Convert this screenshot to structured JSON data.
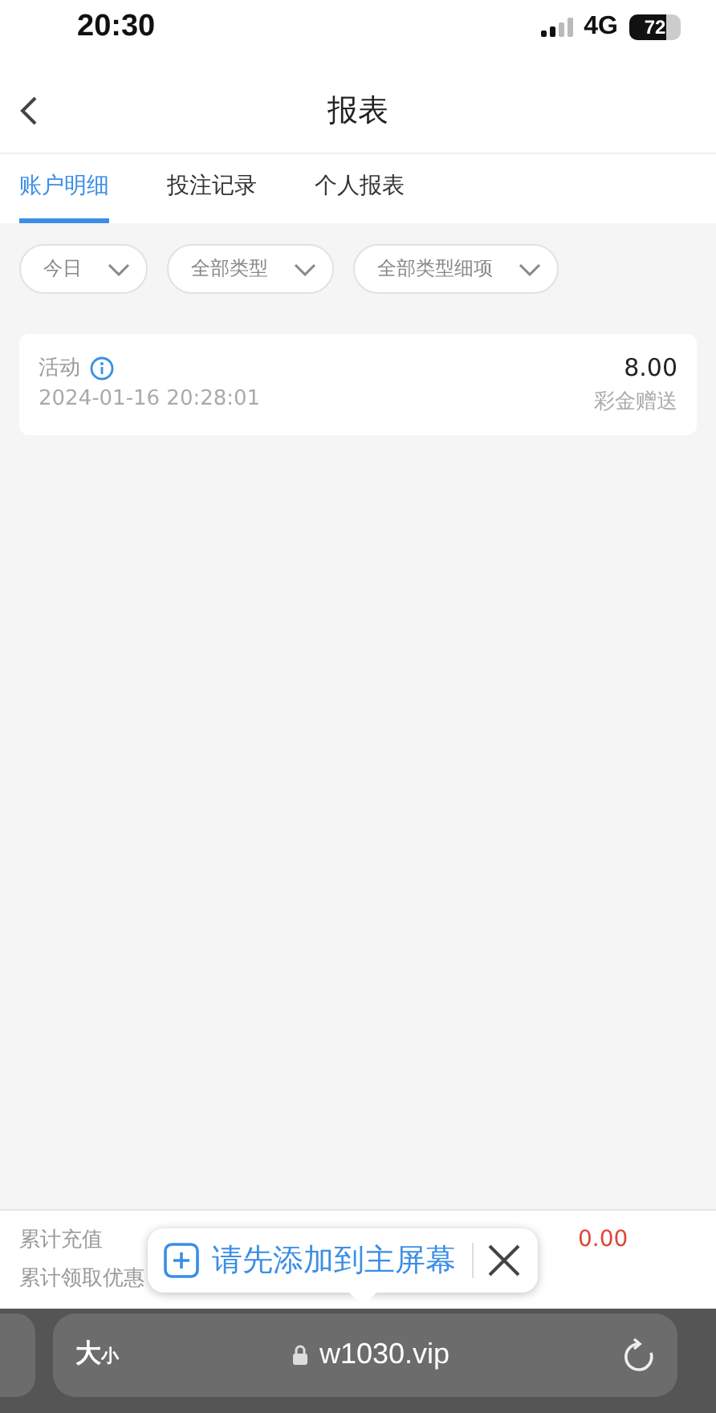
{
  "status_bar": {
    "time": "20:30",
    "network": "4G",
    "battery": "72"
  },
  "header": {
    "title": "报表"
  },
  "tabs": [
    {
      "label": "账户明细",
      "selected": true
    },
    {
      "label": "投注记录",
      "selected": false
    },
    {
      "label": "个人报表",
      "selected": false
    }
  ],
  "filters": [
    {
      "label": "今日"
    },
    {
      "label": "全部类型"
    },
    {
      "label": "全部类型细项"
    }
  ],
  "records": [
    {
      "title": "活动",
      "time": "2024-01-16 20:28:01",
      "amount": "8.00",
      "type": "彩金赠送"
    }
  ],
  "summary": {
    "rows": [
      {
        "label": "累计充值",
        "value": "0.00"
      },
      {
        "label": "累计领取优惠"
      }
    ]
  },
  "popup": {
    "text": "请先添加到主屏幕"
  },
  "browser": {
    "text_size": "大$_{小}$",
    "url": "w1030.vip"
  }
}
